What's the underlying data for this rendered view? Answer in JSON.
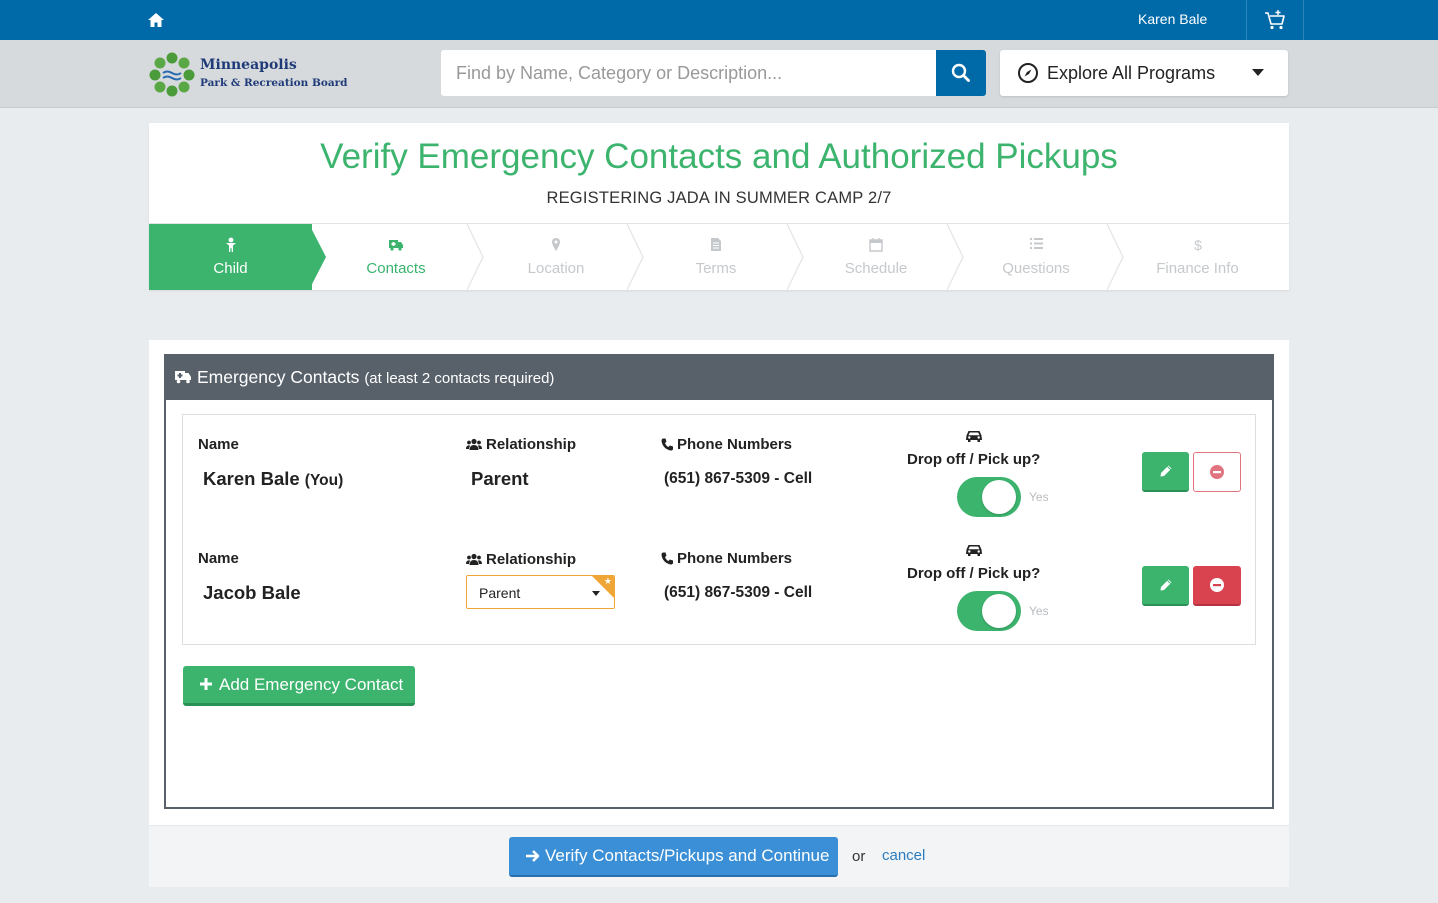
{
  "topbar": {
    "user_name": "Karen Bale"
  },
  "header": {
    "logo_line1": "Minneapolis",
    "logo_line2": "Park & Recreation Board",
    "search_placeholder": "Find by Name, Category or Description...",
    "explore_label": "Explore All Programs"
  },
  "page": {
    "title": "Verify Emergency Contacts and Authorized Pickups",
    "subtitle": "REGISTERING JADA IN SUMMER CAMP 2/7"
  },
  "steps": [
    {
      "label": "Child",
      "state": "active",
      "icon": "child-icon"
    },
    {
      "label": "Contacts",
      "state": "current",
      "icon": "ambulance-icon"
    },
    {
      "label": "Location",
      "state": "future",
      "icon": "map-pin-icon"
    },
    {
      "label": "Terms",
      "state": "future",
      "icon": "document-icon"
    },
    {
      "label": "Schedule",
      "state": "future",
      "icon": "calendar-icon"
    },
    {
      "label": "Questions",
      "state": "future",
      "icon": "list-icon"
    },
    {
      "label": "Finance Info",
      "state": "future",
      "icon": "dollar-icon"
    }
  ],
  "panel": {
    "title": "Emergency Contacts",
    "note": "(at least 2 contacts required)",
    "labels": {
      "name": "Name",
      "relationship": "Relationship",
      "phone": "Phone Numbers",
      "dropoff": "Drop off / Pick up?",
      "toggle_yes": "Yes"
    },
    "contacts": [
      {
        "name": "Karen Bale",
        "you_tag": "(You)",
        "relationship": "Parent",
        "phone": "(651) 867-5309 - Cell",
        "pickup": true
      },
      {
        "name": "Jacob Bale",
        "relationship_select": "Parent",
        "phone": "(651) 867-5309 - Cell",
        "pickup": true
      }
    ],
    "add_label": "Add Emergency Contact"
  },
  "footer": {
    "verify_label": "Verify Contacts/Pickups and Continue",
    "or_text": "or",
    "cancel_label": "cancel"
  },
  "colors": {
    "topbar": "#006aa8",
    "accent_green": "#3cb46e",
    "panel_header": "#58616a",
    "primary_blue": "#3a8fd6",
    "danger_red": "#d9434f",
    "select_warning": "#f0a637"
  }
}
